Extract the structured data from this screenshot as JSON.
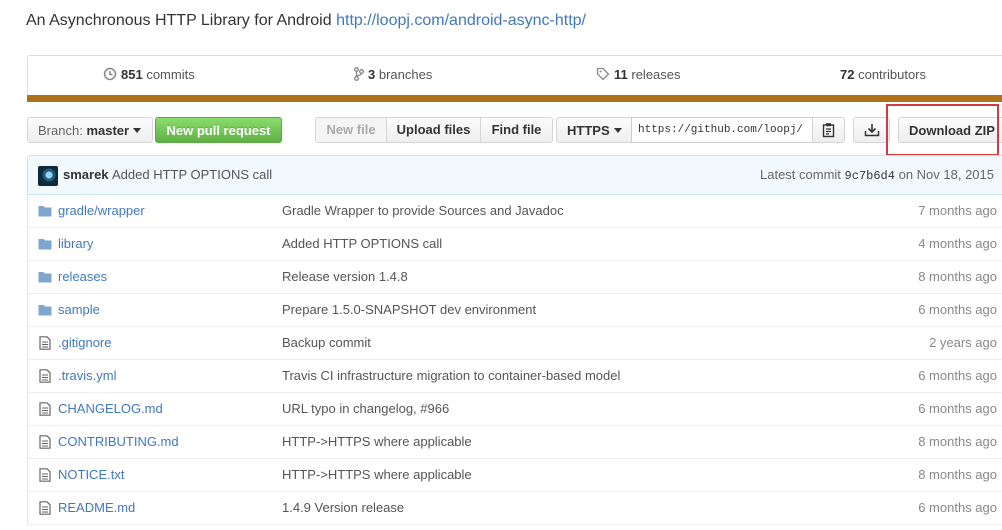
{
  "repo": {
    "description": "An Asynchronous HTTP Library for Android",
    "homepage": "http://loopj.com/android-async-http/"
  },
  "summary": {
    "commits": {
      "count": "851",
      "label": "commits"
    },
    "branches": {
      "count": "3",
      "label": "branches"
    },
    "releases": {
      "count": "11",
      "label": "releases"
    },
    "contributors": {
      "count": "72",
      "label": "contributors"
    },
    "language_color": "#b07219"
  },
  "toolbar": {
    "branch_prefix": "Branch:",
    "branch_name": "master",
    "new_pr": "New pull request",
    "new_file": "New file",
    "upload_files": "Upload files",
    "find_file": "Find file",
    "protocol": "HTTPS",
    "clone_url": "https://github.com/loopj/",
    "download_zip": "Download ZIP"
  },
  "latest_commit": {
    "author": "smarek",
    "message": "Added HTTP OPTIONS call",
    "label": "Latest commit",
    "sha": "9c7b6d4",
    "date": "on Nov 18, 2015"
  },
  "files": [
    {
      "type": "folder",
      "name": "gradle/wrapper",
      "message": "Gradle Wrapper to provide Sources and Javadoc",
      "age": "7 months ago"
    },
    {
      "type": "folder",
      "name": "library",
      "message": "Added HTTP OPTIONS call",
      "age": "4 months ago"
    },
    {
      "type": "folder",
      "name": "releases",
      "message": "Release version 1.4.8",
      "age": "8 months ago"
    },
    {
      "type": "folder",
      "name": "sample",
      "message": "Prepare 1.5.0-SNAPSHOT dev environment",
      "age": "6 months ago"
    },
    {
      "type": "file",
      "name": ".gitignore",
      "message": "Backup commit",
      "age": "2 years ago"
    },
    {
      "type": "file",
      "name": ".travis.yml",
      "message": "Travis CI infrastructure migration to container-based model",
      "age": "6 months ago"
    },
    {
      "type": "file",
      "name": "CHANGELOG.md",
      "message": "URL typo in changelog, #966",
      "age": "6 months ago"
    },
    {
      "type": "file",
      "name": "CONTRIBUTING.md",
      "message": "HTTP->HTTPS where applicable",
      "age": "8 months ago"
    },
    {
      "type": "file",
      "name": "NOTICE.txt",
      "message": "HTTP->HTTPS where applicable",
      "age": "8 months ago"
    },
    {
      "type": "file",
      "name": "README.md",
      "message": "1.4.9 Version release",
      "age": "6 months ago"
    }
  ],
  "colors": {
    "link": "#4078c0",
    "primary_green": "#60b044",
    "highlight_red": "#d9383f",
    "folder_icon": "#80a6cd"
  }
}
